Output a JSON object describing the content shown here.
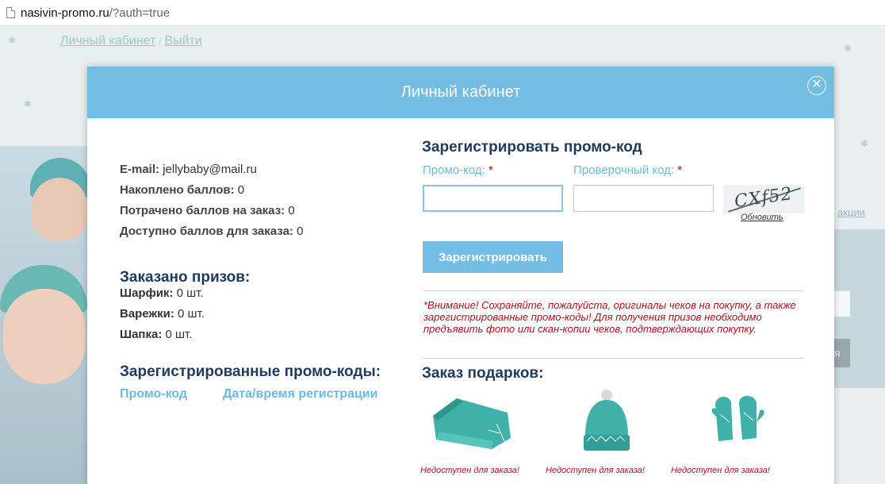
{
  "browser": {
    "url_host": "nasivin-promo.ru",
    "url_path": "/?auth=true"
  },
  "background": {
    "top_link_account": "Личный кабинет",
    "top_link_logout": "Выйти",
    "top_link_separator": "/",
    "right_link": "акции",
    "right_button": "я"
  },
  "modal": {
    "title": "Личный кабинет",
    "close_symbol": "✕"
  },
  "account": {
    "email_label": "E-mail:",
    "email_value": "jellybaby@mail.ru",
    "points_earned_label": "Накоплено баллов:",
    "points_earned_value": "0",
    "points_spent_label": "Потрачено баллов на заказ:",
    "points_spent_value": "0",
    "points_available_label": "Доступно баллов для заказа:",
    "points_available_value": "0"
  },
  "prizes": {
    "heading": "Заказано призов:",
    "items": [
      {
        "label": "Шарфик:",
        "value": "0 шт."
      },
      {
        "label": "Варежки:",
        "value": "0 шт."
      },
      {
        "label": "Шапка:",
        "value": "0 шт."
      }
    ]
  },
  "codes": {
    "heading": "Зарегистрированные промо-коды:",
    "col_code": "Промо-код",
    "col_date": "Дата/время регистрации"
  },
  "register": {
    "heading": "Зарегистрировать промо-код",
    "promo_label": "Промо-код:",
    "check_label": "Проверочный код:",
    "required_mark": "*",
    "promo_value": "",
    "check_value": "",
    "captcha_text": "CXf52",
    "refresh_label": "Обновить",
    "button_label": "Зарегистрировать",
    "warning": "*Внимание! Сохраняйте, пожалуйста, оригиналы чеков на покупку, а также зарегистрированные промо-коды! Для получения призов необходимо предъявить фото или скан-копии чеков, подтверждающих покупку."
  },
  "order": {
    "heading": "Заказ подарков:",
    "gifts": [
      {
        "icon": "scarf-icon",
        "note": "Недоступен для заказа!"
      },
      {
        "icon": "hat-icon",
        "note": "Недоступен для заказа!"
      },
      {
        "icon": "mittens-icon",
        "note": "Недоступен для заказа!"
      }
    ]
  },
  "colors": {
    "header": "#73bde3",
    "accent_text": "#6fb9e0",
    "heading_text": "#1f3a5c",
    "warning_text": "#a8141c",
    "gift_teal": "#3fb1a8"
  }
}
